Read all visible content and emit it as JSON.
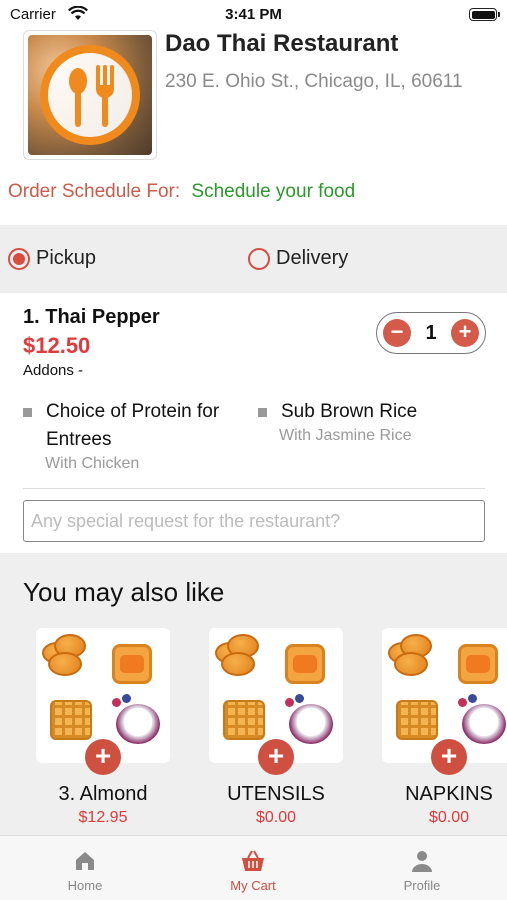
{
  "status_bar": {
    "carrier": "Carrier",
    "time": "3:41 PM"
  },
  "restaurant": {
    "name": "Dao Thai Restaurant",
    "address": "230 E. Ohio St., Chicago, IL, 60611"
  },
  "schedule": {
    "label": "Order Schedule For:",
    "value": "Schedule your food"
  },
  "order_type": {
    "options": [
      {
        "label": "Pickup",
        "selected": true
      },
      {
        "label": "Delivery",
        "selected": false
      }
    ]
  },
  "cart_item": {
    "title": "1. Thai Pepper",
    "price": "$12.50",
    "addons_label": "Addons -",
    "quantity": "1",
    "decrement": "−",
    "increment": "+",
    "addons": [
      {
        "name": "Choice of Protein for Entrees",
        "value": "With Chicken"
      },
      {
        "name": "Sub Brown Rice",
        "value": "With Jasmine Rice"
      }
    ]
  },
  "special_request": {
    "placeholder": "Any special request for the restaurant?"
  },
  "suggestions": {
    "title": "You may also like",
    "add_symbol": "+",
    "items": [
      {
        "name": "3. Almond",
        "price": "$12.95"
      },
      {
        "name": "UTENSILS",
        "price": "$0.00"
      },
      {
        "name": "NAPKINS",
        "price": "$0.00"
      }
    ]
  },
  "tab_bar": {
    "tabs": [
      {
        "label": "Home",
        "icon": "home-icon",
        "active": false
      },
      {
        "label": "My Cart",
        "icon": "basket-icon",
        "active": true
      },
      {
        "label": "Profile",
        "icon": "person-icon",
        "active": false
      }
    ]
  },
  "colors": {
    "accent": "#cf4f40",
    "price": "#e23a3a",
    "schedule_value": "#2a9a2a",
    "schedule_label": "#cf5a4a"
  }
}
